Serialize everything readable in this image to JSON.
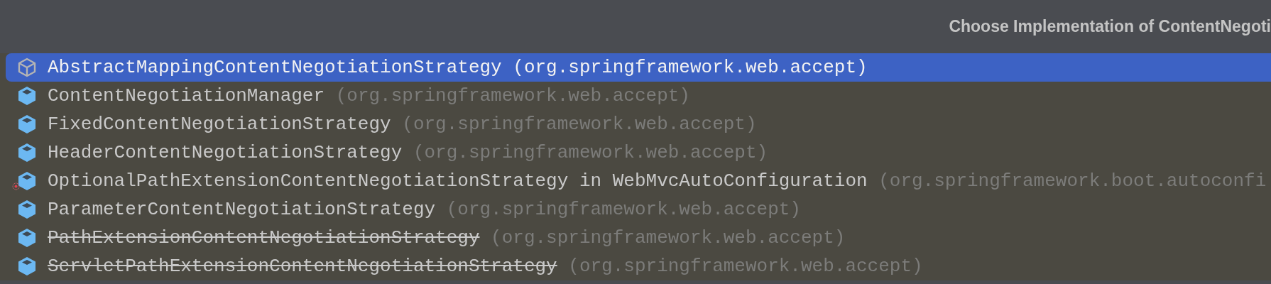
{
  "popup": {
    "title": "Choose Implementation of ContentNegoti",
    "items": [
      {
        "kind": "abstract",
        "name": "AbstractMappingContentNegotiationStrategy",
        "qualifier": "(org.springframework.web.accept)",
        "selected": true,
        "deprecated": false,
        "marker": false
      },
      {
        "kind": "class",
        "name": "ContentNegotiationManager",
        "qualifier": "(org.springframework.web.accept)",
        "selected": false,
        "deprecated": false,
        "marker": false
      },
      {
        "kind": "class",
        "name": "FixedContentNegotiationStrategy",
        "qualifier": "(org.springframework.web.accept)",
        "selected": false,
        "deprecated": false,
        "marker": false
      },
      {
        "kind": "class",
        "name": "HeaderContentNegotiationStrategy",
        "qualifier": "(org.springframework.web.accept)",
        "selected": false,
        "deprecated": false,
        "marker": false
      },
      {
        "kind": "class",
        "name": "OptionalPathExtensionContentNegotiationStrategy in WebMvcAutoConfiguration",
        "qualifier": "(org.springframework.boot.autoconfi",
        "selected": false,
        "deprecated": false,
        "marker": true
      },
      {
        "kind": "class",
        "name": "ParameterContentNegotiationStrategy",
        "qualifier": "(org.springframework.web.accept)",
        "selected": false,
        "deprecated": false,
        "marker": false
      },
      {
        "kind": "class",
        "name": "PathExtensionContentNegotiationStrategy",
        "qualifier": "(org.springframework.web.accept)",
        "selected": false,
        "deprecated": true,
        "marker": false
      },
      {
        "kind": "class",
        "name": "ServletPathExtensionContentNegotiationStrategy",
        "qualifier": "(org.springframework.web.accept)",
        "selected": false,
        "deprecated": true,
        "marker": false
      }
    ]
  }
}
